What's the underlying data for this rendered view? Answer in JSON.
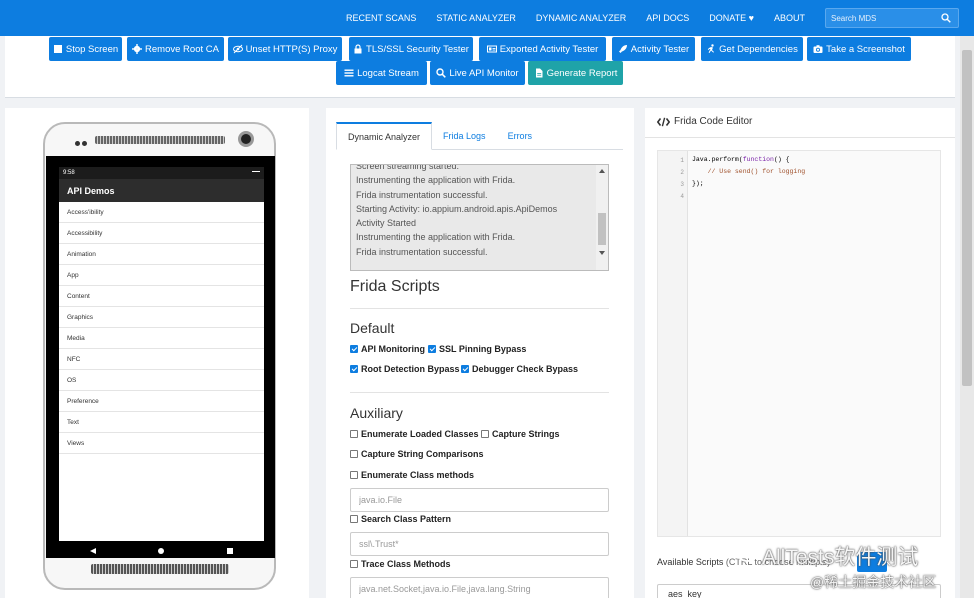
{
  "nav": {
    "items": [
      "RECENT SCANS",
      "STATIC ANALYZER",
      "DYNAMIC ANALYZER",
      "API DOCS",
      "DONATE ♥",
      "ABOUT"
    ],
    "search_placeholder": "Search MDS"
  },
  "toolbar": {
    "row1": [
      "Stop Screen",
      "Remove Root CA",
      "Unset HTTP(S) Proxy",
      "TLS/SSL Security Tester",
      "Exported Activity Tester",
      "Activity Tester",
      "Get Dependencies",
      "Take a Screenshot"
    ],
    "row2": [
      "Logcat Stream",
      "Live API Monitor",
      "Generate Report"
    ]
  },
  "phone": {
    "time": "9:58",
    "app_title": "API Demos",
    "list": [
      "Access'ibility",
      "Accessibility",
      "Animation",
      "App",
      "Content",
      "Graphics",
      "Media",
      "NFC",
      "OS",
      "Preference",
      "Text",
      "Views"
    ]
  },
  "analyzer": {
    "tabs": [
      "Dynamic Analyzer",
      "Frida Logs",
      "Errors"
    ],
    "log_lines": [
      "Screen streaming started.",
      "Instrumenting the application with Frida.",
      "Frida instrumentation successful.",
      "Starting Activity: io.appium.android.apis.ApiDemos",
      "Activity Started",
      "Instrumenting the application with Frida.",
      "Frida instrumentation successful."
    ],
    "scripts_heading": "Frida Scripts",
    "default_heading": "Default",
    "default_checks": [
      {
        "label": "API Monitoring",
        "checked": true
      },
      {
        "label": "SSL Pinning Bypass",
        "checked": true
      },
      {
        "label": "Root Detection Bypass",
        "checked": true
      },
      {
        "label": "Debugger Check Bypass",
        "checked": true
      }
    ],
    "aux_heading": "Auxiliary",
    "aux_checks": [
      {
        "label": "Enumerate Loaded Classes",
        "checked": false
      },
      {
        "label": "Capture Strings",
        "checked": false
      },
      {
        "label": "Capture String Comparisons",
        "checked": false
      },
      {
        "label": "Enumerate Class methods",
        "checked": false
      },
      {
        "label": "Search Class Pattern",
        "checked": false
      },
      {
        "label": "Trace Class Methods",
        "checked": false
      }
    ],
    "class_methods_placeholder": "java.io.File",
    "class_pattern_placeholder": "ssl\\.Trust*",
    "trace_methods_placeholder": "java.net.Socket,java.io.File,java.lang.String"
  },
  "editor": {
    "title": "Frida Code Editor",
    "line_numbers": [
      "1",
      "2",
      "3",
      "4"
    ],
    "code_line1_a": "Java.",
    "code_line1_b": "perform",
    "code_line1_c": "(",
    "code_line1_kw": "function",
    "code_line1_d": "() {",
    "code_line2": "    // Use send() for logging",
    "code_line3": "});",
    "available_label": "Available Scripts",
    "available_note": "(CTRL to choose multiple)",
    "script_option": "aes_key"
  },
  "watermark": {
    "line1": "AllTests软件测试",
    "line2": "@稀土掘金技术社区"
  },
  "colors": {
    "primary": "#0d7de0",
    "teal": "#1fa3a8"
  }
}
